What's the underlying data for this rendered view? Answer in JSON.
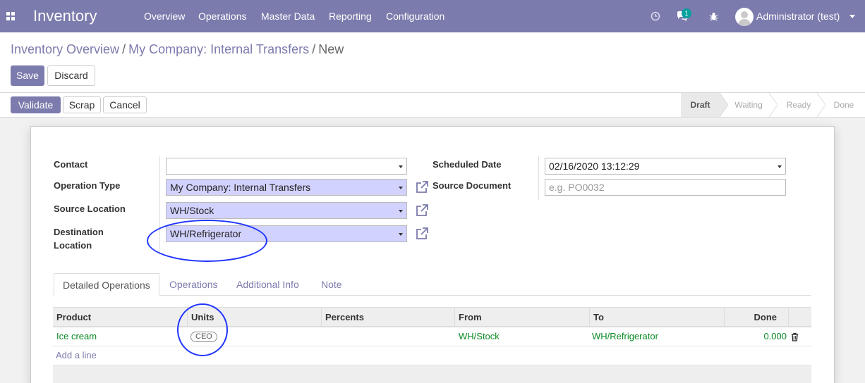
{
  "navbar": {
    "brand": "Inventory",
    "menu": [
      "Overview",
      "Operations",
      "Master Data",
      "Reporting",
      "Configuration"
    ],
    "messages_count": "1",
    "user_name": "Administrator (test)"
  },
  "breadcrumb": {
    "items": [
      "Inventory Overview",
      "My Company: Internal Transfers",
      "New"
    ]
  },
  "actions": {
    "save": "Save",
    "discard": "Discard"
  },
  "header_buttons": {
    "validate": "Validate",
    "scrap": "Scrap",
    "cancel": "Cancel"
  },
  "statusbar": [
    "Draft",
    "Waiting",
    "Ready",
    "Done"
  ],
  "form": {
    "contact": {
      "label": "Contact",
      "value": ""
    },
    "operation_type": {
      "label": "Operation Type",
      "value": "My Company: Internal Transfers"
    },
    "source_location": {
      "label": "Source Location",
      "value": "WH/Stock"
    },
    "destination_location": {
      "label_line1": "Destination",
      "label_line2": "Location",
      "value": "WH/Refrigerator"
    },
    "scheduled_date": {
      "label": "Scheduled Date",
      "value": "02/16/2020 13:12:29"
    },
    "source_document": {
      "label": "Source Document",
      "placeholder": "e.g. PO0032"
    }
  },
  "tabs": [
    "Detailed Operations",
    "Operations",
    "Additional Info",
    "Note"
  ],
  "table": {
    "columns": [
      "Product",
      "Units",
      "Percents",
      "From",
      "To",
      "Done"
    ],
    "rows": [
      {
        "product": "Ice cream",
        "units": "CEO",
        "percents": "",
        "from": "WH/Stock",
        "to": "WH/Refrigerator",
        "done": "0.000"
      }
    ],
    "add_line": "Add a line"
  },
  "colors": {
    "brand": "#7c7bad",
    "required_field": "#d2d2ff",
    "annotation": "#2035ff",
    "link_green": "#0a8a24"
  }
}
